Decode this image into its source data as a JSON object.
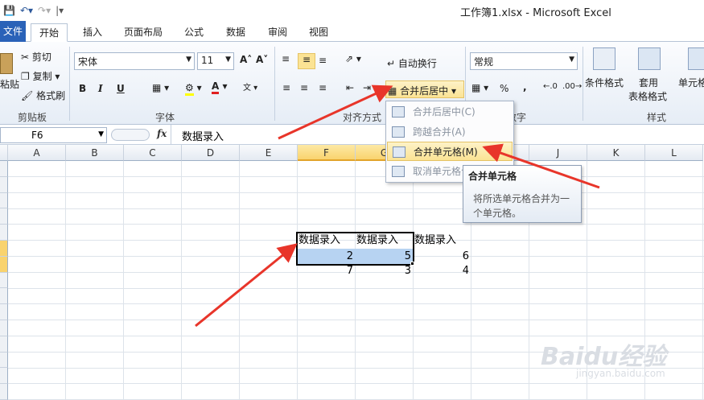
{
  "window": {
    "title": "工作簿1.xlsx  -  Microsoft Excel"
  },
  "tabs": {
    "file": "文件",
    "home": "开始",
    "insert": "插入",
    "layout": "页面布局",
    "formulas": "公式",
    "data": "数据",
    "review": "审阅",
    "view": "视图"
  },
  "ribbon": {
    "clipboard": {
      "paste": "粘贴",
      "cut": "剪切",
      "copy": "复制",
      "painter": "格式刷",
      "label": "剪贴板"
    },
    "font": {
      "name": "宋体",
      "size": "11",
      "bold": "B",
      "italic": "I",
      "underline": "U",
      "label": "字体"
    },
    "alignment": {
      "wrap": "自动换行",
      "merge_center": "合并后居中",
      "label": "对齐方式"
    },
    "number": {
      "format": "常规",
      "percent": "%",
      "comma": ",",
      "label": "数字"
    },
    "styles": {
      "conditional": "条件格式",
      "table1": "套用",
      "table2": "表格格式",
      "cell": "单元格",
      "label": "样式"
    }
  },
  "formula_bar": {
    "name_box": "F6",
    "fx": "fx",
    "content": "数据录入"
  },
  "columns": [
    "A",
    "B",
    "C",
    "D",
    "E",
    "F",
    "G",
    "H",
    "I",
    "J",
    "K",
    "L"
  ],
  "cells": {
    "f5": "数据录入",
    "g5": "数据录入",
    "h5": "数据录入",
    "f6": "2",
    "g6": "5",
    "h6": "6",
    "f7": "7",
    "g7": "3",
    "h7": "4"
  },
  "merge_menu": {
    "items": [
      {
        "label": "合并后居中(C)"
      },
      {
        "label": "跨越合并(A)"
      },
      {
        "label": "合并单元格(M)"
      },
      {
        "label": "取消单元格合并(U)"
      }
    ]
  },
  "tooltip": {
    "title": "合并单元格",
    "body": "将所选单元格合并为一个单元格。"
  },
  "watermark": {
    "brand": "Baidu经验",
    "url": "jingyan.baidu.com"
  },
  "colors": {
    "accent": "#2a62b8",
    "selection": "#b7d3f2",
    "highlight": "#fbe394",
    "arrow": "#e8352a"
  }
}
